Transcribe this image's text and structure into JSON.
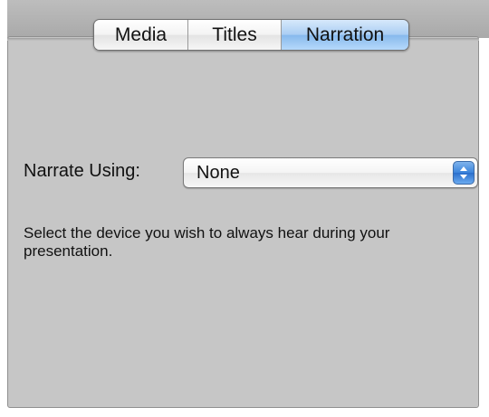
{
  "tabs": [
    {
      "label": "Media",
      "selected": false
    },
    {
      "label": "Titles",
      "selected": false
    },
    {
      "label": "Narration",
      "selected": true
    }
  ],
  "narration": {
    "label": "Narrate Using:",
    "selected_value": "None",
    "help_text": "Select the device you wish to always hear during your presentation."
  },
  "icons": {
    "select_arrows": "up-down-chevrons-icon"
  },
  "colors": {
    "panel_background": "#c6c6c6",
    "selected_tab": "#86b9ec",
    "select_arrow_button": "#3b84dc"
  }
}
